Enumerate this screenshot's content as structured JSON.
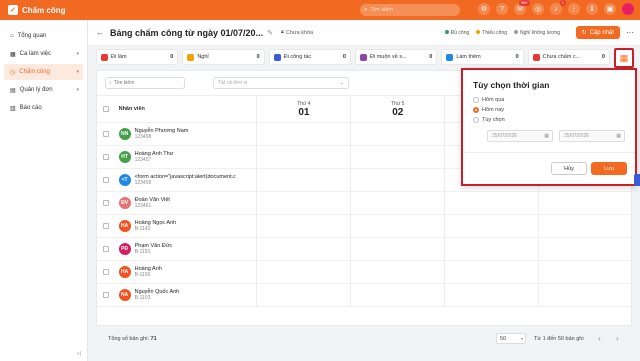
{
  "app": {
    "title": "Chấm công",
    "search_placeholder": "Tìm kiếm",
    "notifications": {
      "mail": "99+",
      "bell": "1"
    }
  },
  "sidebar": {
    "items": [
      {
        "label": "Tổng quan",
        "icon": "home-icon",
        "active": false,
        "chevron": false
      },
      {
        "label": "Ca làm việc",
        "icon": "calendar-icon",
        "active": false,
        "chevron": true
      },
      {
        "label": "Chấm công",
        "icon": "clock-icon",
        "active": true,
        "chevron": true
      },
      {
        "label": "Quản lý đơn",
        "icon": "document-icon",
        "active": false,
        "chevron": true
      },
      {
        "label": "Báo cáo",
        "icon": "report-icon",
        "active": false,
        "chevron": false
      }
    ]
  },
  "header": {
    "title": "Bảng chấm công từ ngày 01/07/20...",
    "lock_label": "Chưa khóa",
    "legend": [
      {
        "label": "Đủ công",
        "color": "#2e9d5b"
      },
      {
        "label": "Thiếu công",
        "color": "#f2a100"
      },
      {
        "label": "Nghỉ không lương",
        "color": "#9e9e9e"
      }
    ],
    "update_label": "Cập nhật"
  },
  "stats": [
    {
      "label": "Đi làm",
      "count": "0",
      "color": "#e53935"
    },
    {
      "label": "Nghỉ",
      "count": "0",
      "color": "#f2a100"
    },
    {
      "label": "Đi công tác",
      "count": "0",
      "color": "#3a5bd9"
    },
    {
      "label": "Đi muộn về s...",
      "count": "0",
      "color": "#8e44ad"
    },
    {
      "label": "Làm thêm",
      "count": "0",
      "color": "#1e88e5"
    },
    {
      "label": "Chưa chấm c...",
      "count": "0",
      "color": "#e53935"
    }
  ],
  "table": {
    "search_placeholder": "Tìm kiếm",
    "unit_placeholder": "Tất cả đơn vị",
    "employee_header": "Nhân viên",
    "days": [
      {
        "name": "Thứ 4",
        "date": "01"
      },
      {
        "name": "Thứ 5",
        "date": "02"
      },
      {
        "name": "",
        "date": ""
      },
      {
        "name": "",
        "date": ""
      }
    ],
    "rows": [
      {
        "initials": "NN",
        "color": "#43a047",
        "name": "Nguyễn Phương Nam",
        "code": "123458"
      },
      {
        "initials": "HT",
        "color": "#43a047",
        "name": "Hoàng Anh Thư",
        "code": "123457"
      },
      {
        "initials": "<T",
        "color": "#1e88e5",
        "name": "<form action=\"javascript:alert(document.c",
        "code": "123459"
      },
      {
        "initials": "ĐV",
        "color": "#e57373",
        "name": "Đoàn Văn Việt",
        "code": "123461"
      },
      {
        "initials": "HA",
        "color": "#f4511e",
        "name": "Hoàng Ngọc Anh",
        "code": "B-1142"
      },
      {
        "initials": "PĐ",
        "color": "#d81b60",
        "name": "Phạm Văn Đức",
        "code": "B-1151"
      },
      {
        "initials": "HA",
        "color": "#f4511e",
        "name": "Hoàng Anh",
        "code": "B-1100"
      },
      {
        "initials": "NA",
        "color": "#f4511e",
        "name": "Nguyễn Quốc Anh",
        "code": "B-1103"
      }
    ]
  },
  "footer": {
    "total_label": "Tổng số bản ghi:",
    "total": "71",
    "page_size": "50",
    "range": "Từ 1 đến 50 bản ghi"
  },
  "popover": {
    "title": "Tùy chọn thời gian",
    "options": [
      {
        "label": "Hôm qua",
        "selected": false
      },
      {
        "label": "Hôm nay",
        "selected": true
      },
      {
        "label": "Tùy chọn",
        "selected": false
      }
    ],
    "from_date": "25/07/2026",
    "to_date": "25/07/2026",
    "cancel_label": "Hủy",
    "save_label": "Lưu"
  },
  "colors": {
    "brand": "#f26a21",
    "highlight_border": "#c8202a"
  }
}
